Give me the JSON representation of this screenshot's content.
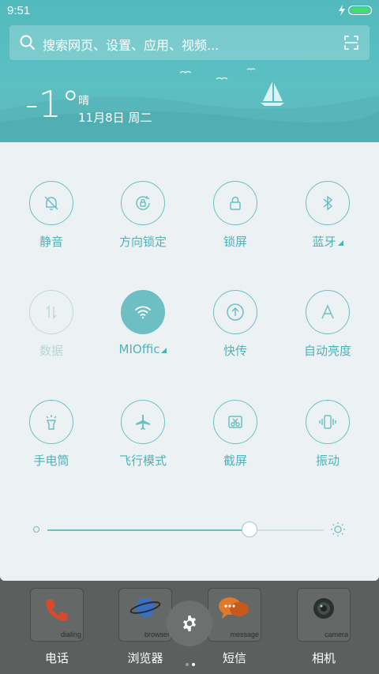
{
  "status": {
    "time": "9:51"
  },
  "search": {
    "placeholder": "搜索网页、设置、应用、视频..."
  },
  "weather": {
    "temperature": "-1°",
    "condition": "晴",
    "date": "11月8日 周二"
  },
  "toggles": [
    {
      "label": "静音",
      "icon": "bell-off-icon",
      "state": "off"
    },
    {
      "label": "方向锁定",
      "icon": "rotation-lock-icon",
      "state": "off"
    },
    {
      "label": "锁屏",
      "icon": "lock-icon",
      "state": "off"
    },
    {
      "label": "蓝牙",
      "icon": "bluetooth-icon",
      "state": "off",
      "has_menu": true
    },
    {
      "label": "数据",
      "icon": "mobile-data-icon",
      "state": "disabled"
    },
    {
      "label": "MIOffic",
      "icon": "wifi-icon",
      "state": "on",
      "has_menu": true
    },
    {
      "label": "快传",
      "icon": "upload-icon",
      "state": "off"
    },
    {
      "label": "自动亮度",
      "icon": "auto-brightness-icon",
      "state": "off"
    },
    {
      "label": "手电筒",
      "icon": "flashlight-icon",
      "state": "off"
    },
    {
      "label": "飞行模式",
      "icon": "airplane-icon",
      "state": "off"
    },
    {
      "label": "截屏",
      "icon": "screenshot-icon",
      "state": "off"
    },
    {
      "label": "振动",
      "icon": "vibrate-icon",
      "state": "off"
    }
  ],
  "brightness": {
    "value": 0.73
  },
  "dock": [
    {
      "name": "电话",
      "icon_caption": "dialing"
    },
    {
      "name": "浏览器",
      "icon_caption": "browser"
    },
    {
      "name": "短信",
      "icon_caption": "message"
    },
    {
      "name": "相机",
      "icon_caption": "camera"
    }
  ],
  "colors": {
    "accent": "#6dbfc4",
    "panel": "#ecf2f3",
    "header": "#5cc0c3"
  }
}
